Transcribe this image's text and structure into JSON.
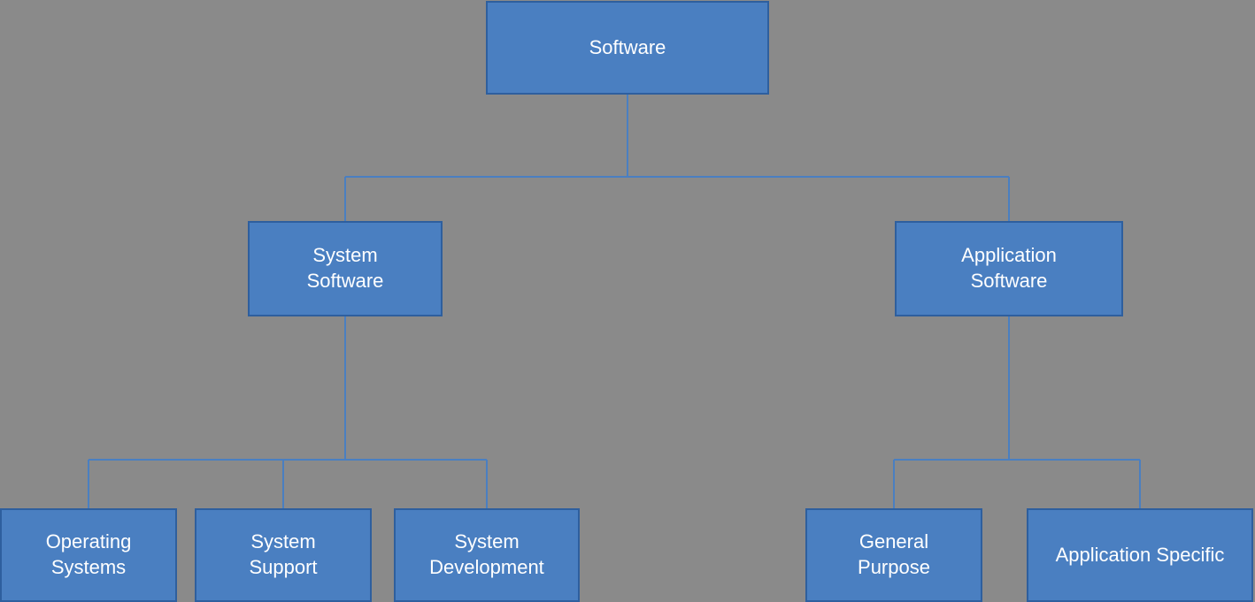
{
  "nodes": {
    "software": {
      "label": "Software"
    },
    "system_software": {
      "label": "System\nSoftware"
    },
    "app_software": {
      "label": "Application\nSoftware"
    },
    "os": {
      "label": "Operating\nSystems"
    },
    "system_support": {
      "label": "System\nSupport"
    },
    "system_dev": {
      "label": "System\nDevelopment"
    },
    "general_purpose": {
      "label": "General\nPurpose"
    },
    "app_specific": {
      "label": "Application\nSpecific"
    }
  },
  "colors": {
    "node_bg": "#4a7fc1",
    "node_border": "#2e5f9e",
    "line_color": "#4a7fc1",
    "bg": "#8a8a8a"
  }
}
